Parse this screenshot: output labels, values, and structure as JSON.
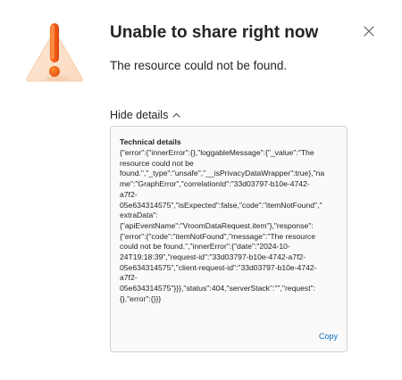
{
  "dialog": {
    "title": "Unable to share right now",
    "message": "The resource could not be found.",
    "close_icon": "close-icon",
    "illustration_icon": "warning-triangle-icon",
    "accent_color": "#f56a1d"
  },
  "details": {
    "toggle_label": "Hide details",
    "toggle_icon": "chevron-up-icon",
    "heading": "Technical details",
    "text": "{\"error\":{\"innerError\":{},\"loggableMessage\":{\"_value\":\"The\nresource could not be\nfound.\",\"_type\":\"unsafe\",\"__isPrivacyDataWrapper\":true},\"na\nme\":\"GraphError\",\"correlationId\":\"33d03797-b10e-4742-\na7f2-\n05e634314575\",\"isExpected\":false,\"code\":\"itemNotFound\",\"\nextraData\":\n{\"apiEventName\":\"VroomDataRequest.item\"},\"response\":\n{\"error\":{\"code\":\"itemNotFound\",\"message\":\"The resource\ncould not be found.\",\"innerError\":{\"date\":\"2024-10-\n24T19:18:39\",\"request-id\":\"33d03797-b10e-4742-a7f2-\n05e634314575\",\"client-request-id\":\"33d03797-b10e-4742-\na7f2-\n05e634314575\"}}},\"status\":404,\"serverStack\":\"\",\"request\":\n{},\"error\":{}}}",
    "copy_label": "Copy",
    "link_color": "#0f6cbd"
  }
}
